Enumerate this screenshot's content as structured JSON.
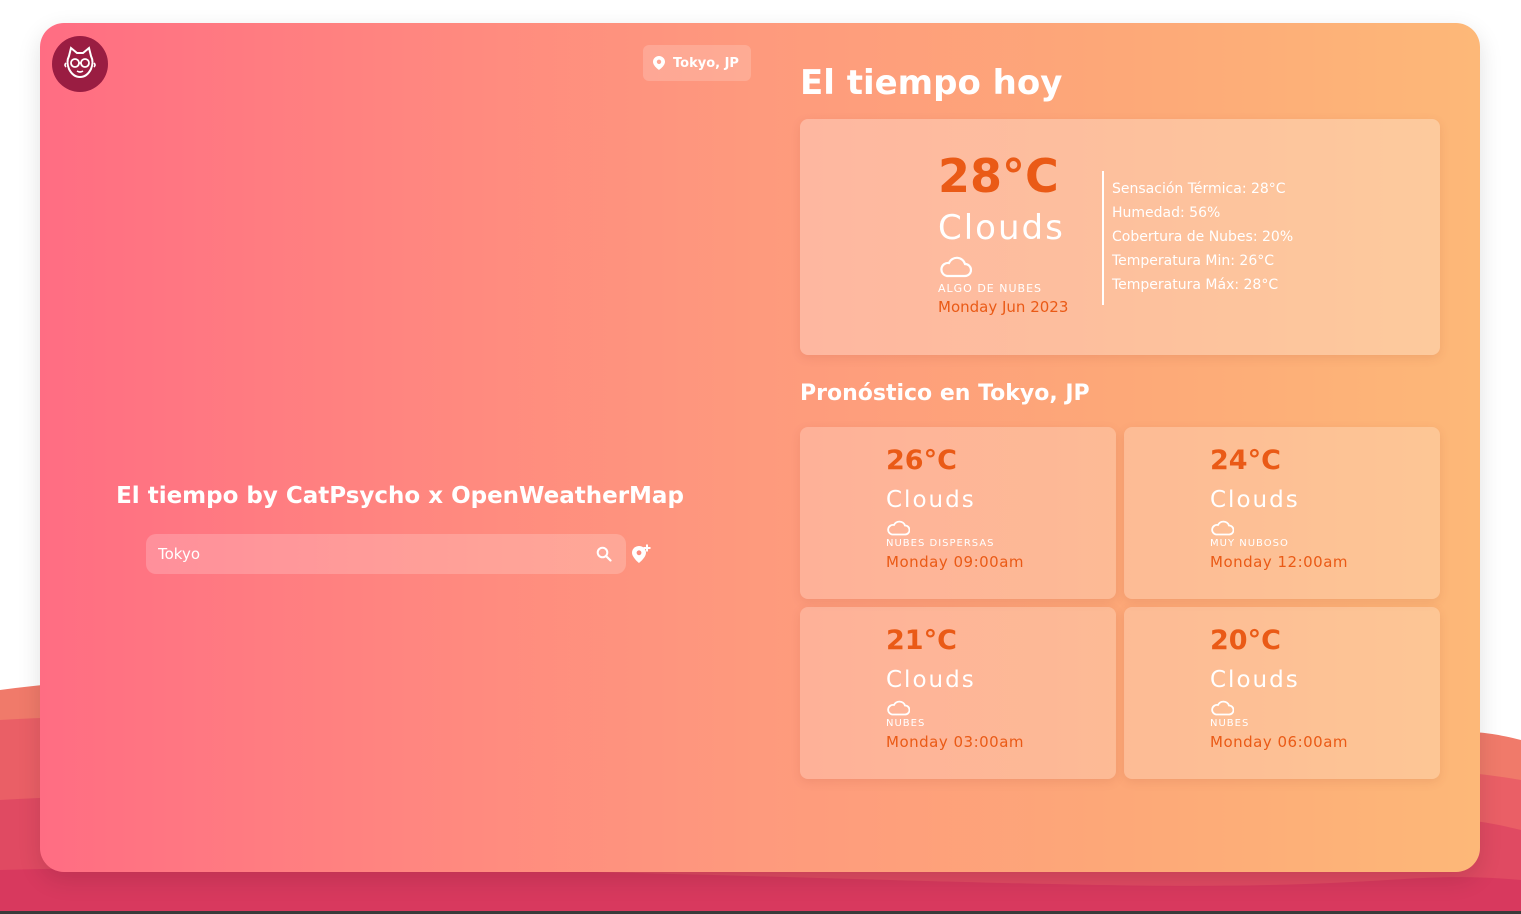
{
  "location_badge": "Tokyo, JP",
  "app_title": "El tiempo by CatPsycho x OpenWeatherMap",
  "search": {
    "value": "Tokyo",
    "placeholder": ""
  },
  "today": {
    "heading": "El tiempo hoy",
    "temp": "28°C",
    "condition": "Clouds",
    "icon": "cloud-icon",
    "description": "ALGO DE NUBES",
    "date": "Monday Jun 2023",
    "details": [
      "Sensación Térmica: 28°C",
      "Humedad: 56%",
      "Cobertura de Nubes: 20%",
      "Temperatura Min: 26°C",
      "Temperatura Máx: 28°C"
    ]
  },
  "forecast": {
    "heading": "Pronóstico en Tokyo, JP",
    "items": [
      {
        "temp": "26°C",
        "condition": "Clouds",
        "icon": "cloud-icon",
        "description": "NUBES DISPERSAS",
        "time": "Monday 09:00am"
      },
      {
        "temp": "24°C",
        "condition": "Clouds",
        "icon": "cloud-icon",
        "description": "MUY NUBOSO",
        "time": "Monday 12:00am"
      },
      {
        "temp": "21°C",
        "condition": "Clouds",
        "icon": "cloud-icon",
        "description": "NUBES",
        "time": "Monday 03:00am"
      },
      {
        "temp": "20°C",
        "condition": "Clouds",
        "icon": "cloud-icon",
        "description": "NUBES",
        "time": "Monday 06:00am"
      }
    ]
  },
  "colors": {
    "accent_temp": "#ea5a16",
    "logo_bg": "#9a1d42",
    "gradient_start": "#ff6d83",
    "gradient_end": "#fdb878"
  }
}
